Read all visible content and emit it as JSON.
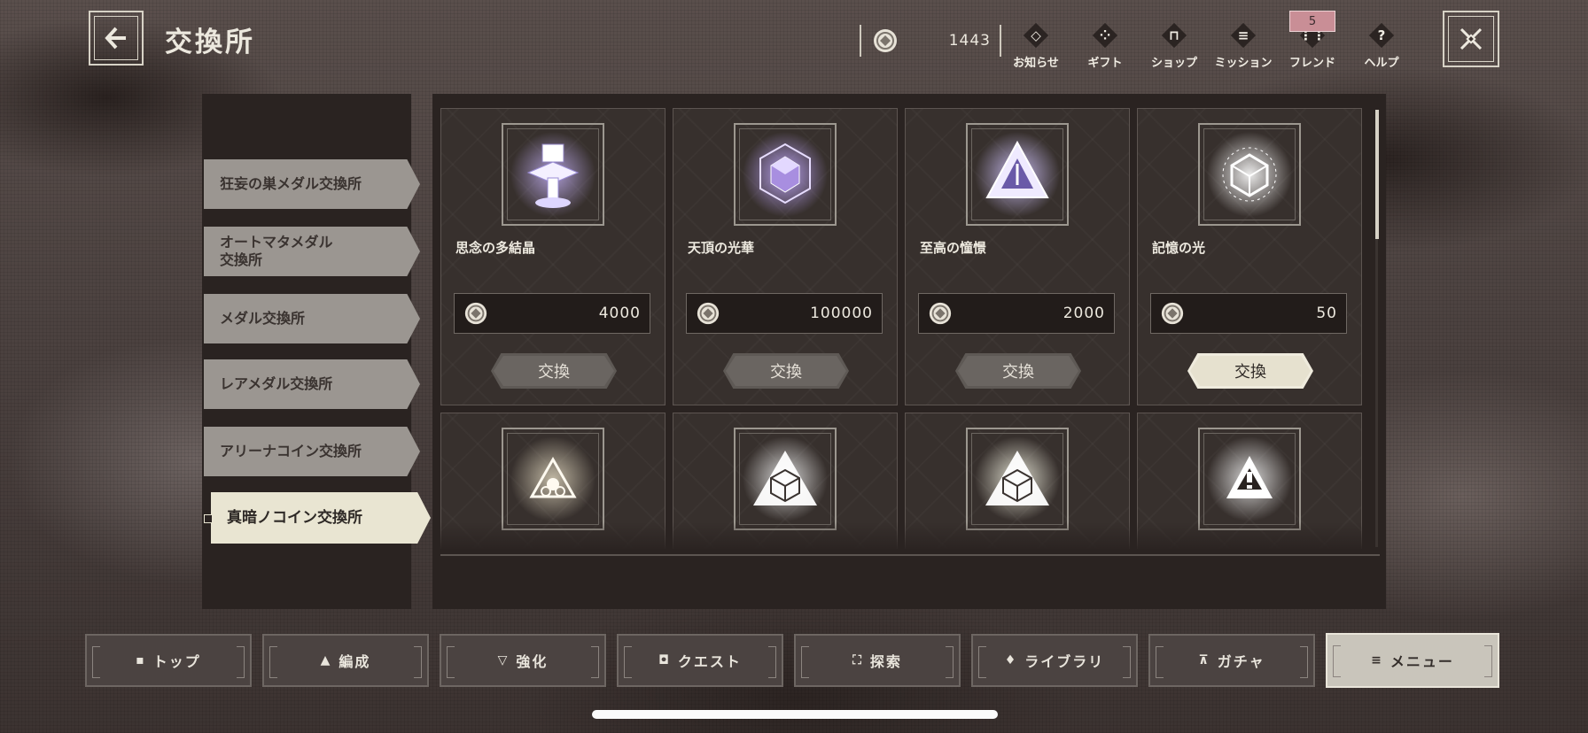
{
  "header": {
    "title": "交換所",
    "currency_amount": "1443",
    "menu": [
      {
        "name": "news",
        "icon": "news-icon",
        "glyph": "◇",
        "label": "お知らせ"
      },
      {
        "name": "gift",
        "icon": "gift-icon",
        "glyph": "⁘",
        "label": "ギフト"
      },
      {
        "name": "shop",
        "icon": "shop-icon",
        "glyph": "⊓",
        "label": "ショップ"
      },
      {
        "name": "mission",
        "icon": "mission-icon",
        "glyph": "≡",
        "label": "ミッション"
      },
      {
        "name": "friend",
        "icon": "friend-icon",
        "glyph": "⋮⋮",
        "label": "フレンド",
        "badge": "5"
      },
      {
        "name": "help",
        "icon": "help-icon",
        "glyph": "?",
        "label": "ヘルプ"
      }
    ]
  },
  "shop_tabs": [
    {
      "label": "狂妄の巣メダル交換所",
      "active": false
    },
    {
      "label": "オートマタメダル\n交換所",
      "active": false
    },
    {
      "label": "メダル交換所",
      "active": false
    },
    {
      "label": "レアメダル交換所",
      "active": false
    },
    {
      "label": "アリーナコイン交換所",
      "active": false
    },
    {
      "label": "真暗ノコイン交換所",
      "active": true
    }
  ],
  "items": [
    {
      "name": "思念の多結晶",
      "price": "4000",
      "exchange_label": "交換",
      "enabled": false,
      "art": "pillar-crystal-icon",
      "tint": "#b9a7e6"
    },
    {
      "name": "天頂の光華",
      "price": "100000",
      "exchange_label": "交換",
      "enabled": false,
      "art": "cube-crystal-icon",
      "tint": "#c2a9ff"
    },
    {
      "name": "至高の憧憬",
      "price": "2000",
      "exchange_label": "交換",
      "enabled": false,
      "art": "triangle-crystal-icon",
      "tint": "#d2c6ff"
    },
    {
      "name": "記憶の光",
      "price": "50",
      "exchange_label": "交換",
      "enabled": true,
      "art": "light-cube-icon",
      "tint": "#ffffff"
    },
    {
      "art": "triangle-core-icon",
      "tint": "#cfc6b0"
    },
    {
      "art": "triangle-cube-icon",
      "tint": "#e8e8e8"
    },
    {
      "art": "triangle-cube-large-icon",
      "tint": "#efeede"
    },
    {
      "art": "triangle-alert-icon",
      "tint": "#e8e8e8"
    }
  ],
  "bottom_nav": [
    {
      "name": "top",
      "icon": "home-icon",
      "glyph": "▪",
      "label": "トップ",
      "active": false
    },
    {
      "name": "formation",
      "icon": "formation-icon",
      "glyph": "▲",
      "label": "編成",
      "active": false
    },
    {
      "name": "enhance",
      "icon": "enhance-icon",
      "glyph": "▽",
      "label": "強化",
      "active": false
    },
    {
      "name": "quest",
      "icon": "quest-icon",
      "glyph": "◘",
      "label": "クエスト",
      "active": false
    },
    {
      "name": "explore",
      "icon": "explore-icon",
      "glyph": "⛶",
      "label": "探索",
      "active": false
    },
    {
      "name": "library",
      "icon": "library-icon",
      "glyph": "♦",
      "label": "ライブラリ",
      "active": false
    },
    {
      "name": "gacha",
      "icon": "gacha-icon",
      "glyph": "⊼",
      "label": "ガチャ",
      "active": false
    },
    {
      "name": "menu",
      "icon": "menu-icon",
      "glyph": "≡",
      "label": "メニュー",
      "active": true
    }
  ]
}
